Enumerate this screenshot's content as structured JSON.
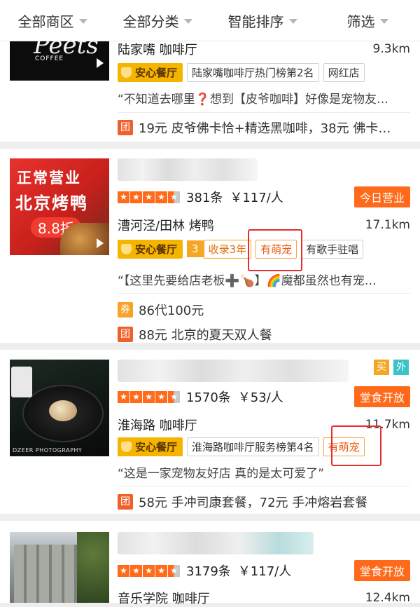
{
  "filters": [
    "全部商区",
    "全部分类",
    "智能排序",
    "筛选"
  ],
  "cards": [
    {
      "thumb_text": "COFFEE",
      "area": "陆家嘴 咖啡厅",
      "distance": "9.3km",
      "tags": [
        "安心餐厅",
        "陆家嘴咖啡厅热门榜第2名",
        "网红店"
      ],
      "quote": "“不知道去哪里❓想到【皮爷咖啡】好像是宠物友…",
      "deals": [
        {
          "icon": "团",
          "text": "19元 皮爷佛卡恰+精选黑咖啡，38元 佛卡…"
        }
      ]
    },
    {
      "thumb_lines": [
        "正常营业",
        "北京烤鸭",
        "8.8折"
      ],
      "reviews": "381条",
      "price": "￥117/人",
      "status": "今日营业",
      "area": "漕河泾/田林 烤鸭",
      "distance": "17.1km",
      "tags": [
        "安心餐厅"
      ],
      "history_num": "3",
      "history_text": "收录3年",
      "extra_tags": [
        "有萌宠",
        "有歌手驻唱"
      ],
      "quote": "“【这里先要给店老板➕🍗】🌈魔都虽然也有宠…",
      "deals": [
        {
          "icon": "券",
          "text": "86代100元"
        },
        {
          "icon": "团",
          "text": "88元 北京的夏天双人餐"
        }
      ]
    },
    {
      "thumb_watermark": "DZEER PHOTOGRAPHY",
      "badges": [
        "买",
        "外"
      ],
      "reviews": "1570条",
      "price": "￥53/人",
      "status": "堂食开放",
      "area": "淮海路 咖啡厅",
      "distance": "11.7km",
      "tags": [
        "安心餐厅",
        "淮海路咖啡厅服务榜第4名",
        "有萌宠"
      ],
      "quote": "“这是一家宠物友好店 真的是太可爱了”",
      "deals": [
        {
          "icon": "团",
          "text": "58元 手冲司康套餐，72元 手冲熔岩套餐"
        }
      ]
    },
    {
      "reviews": "3179条",
      "price": "￥117/人",
      "status": "堂食开放",
      "area": "音乐学院 咖啡厅",
      "distance": "12.4km"
    }
  ]
}
